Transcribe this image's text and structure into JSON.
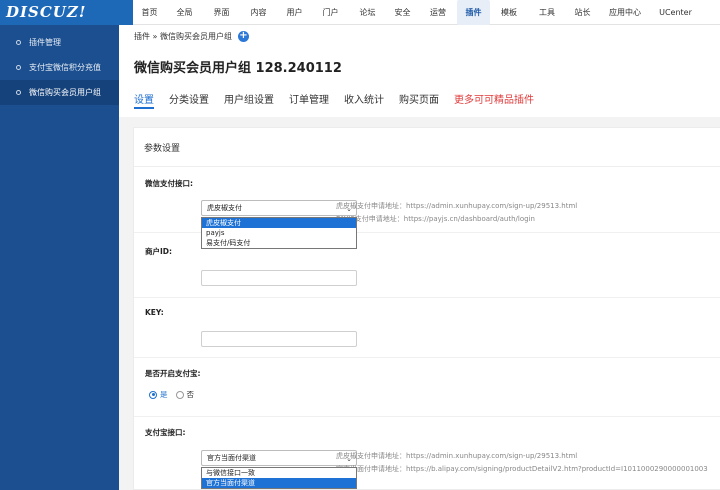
{
  "logo": "DISCUZ!",
  "nav": [
    "首页",
    "全局",
    "界面",
    "内容",
    "用户",
    "门户",
    "论坛",
    "安全",
    "运营",
    "插件",
    "模板",
    "工具",
    "站长",
    "应用中心",
    "UCenter"
  ],
  "nav_active": "插件",
  "sidebar": {
    "items": [
      "插件管理",
      "支付宝微信积分充值",
      "微信购买会员用户组"
    ],
    "active": "微信购买会员用户组"
  },
  "breadcrumb": "插件 » 微信购买会员用户组",
  "page_title": "微信购买会员用户组 128.240112",
  "tabs": [
    {
      "label": "设置",
      "state": "active"
    },
    {
      "label": "分类设置",
      "state": ""
    },
    {
      "label": "用户组设置",
      "state": ""
    },
    {
      "label": "订单管理",
      "state": ""
    },
    {
      "label": "收入统计",
      "state": ""
    },
    {
      "label": "购买页面",
      "state": ""
    },
    {
      "label": "更多可可精品插件",
      "state": "red"
    }
  ],
  "section_title": "参数设置",
  "wechat_pay": {
    "label": "微信支付接口:",
    "selected": "虎皮椒支付",
    "options": [
      "虎皮椒支付",
      "payjs",
      "易支付/码支付"
    ],
    "hint1": "虎皮椒支付申请地址：https://admin.xunhupay.com/sign-up/29513.html",
    "hint2": "PAYJS支付申请地址：https://payjs.cn/dashboard/auth/login"
  },
  "partial_label": "商户ID:",
  "key_label": "KEY:",
  "enable_alipay": {
    "label": "是否开启支付宝:",
    "yes": "是",
    "no": "否",
    "value": "是"
  },
  "alipay": {
    "label": "支付宝接口:",
    "selected": "官方当面付渠道",
    "options": [
      "与微信接口一致",
      "官方当面付渠道"
    ],
    "hint1": "虎皮椒支付申请地址：https://admin.xunhupay.com/sign-up/29513.html",
    "hint2": "官方当面付申请地址：https://b.alipay.com/signing/productDetailV2.htm?productId=I1011000290000001003"
  },
  "colors": {
    "accent": "#1e6fd0",
    "sidebar": "#1b4f8f",
    "logo_bg": "#1e68b8",
    "promo": "#e03b3b"
  }
}
